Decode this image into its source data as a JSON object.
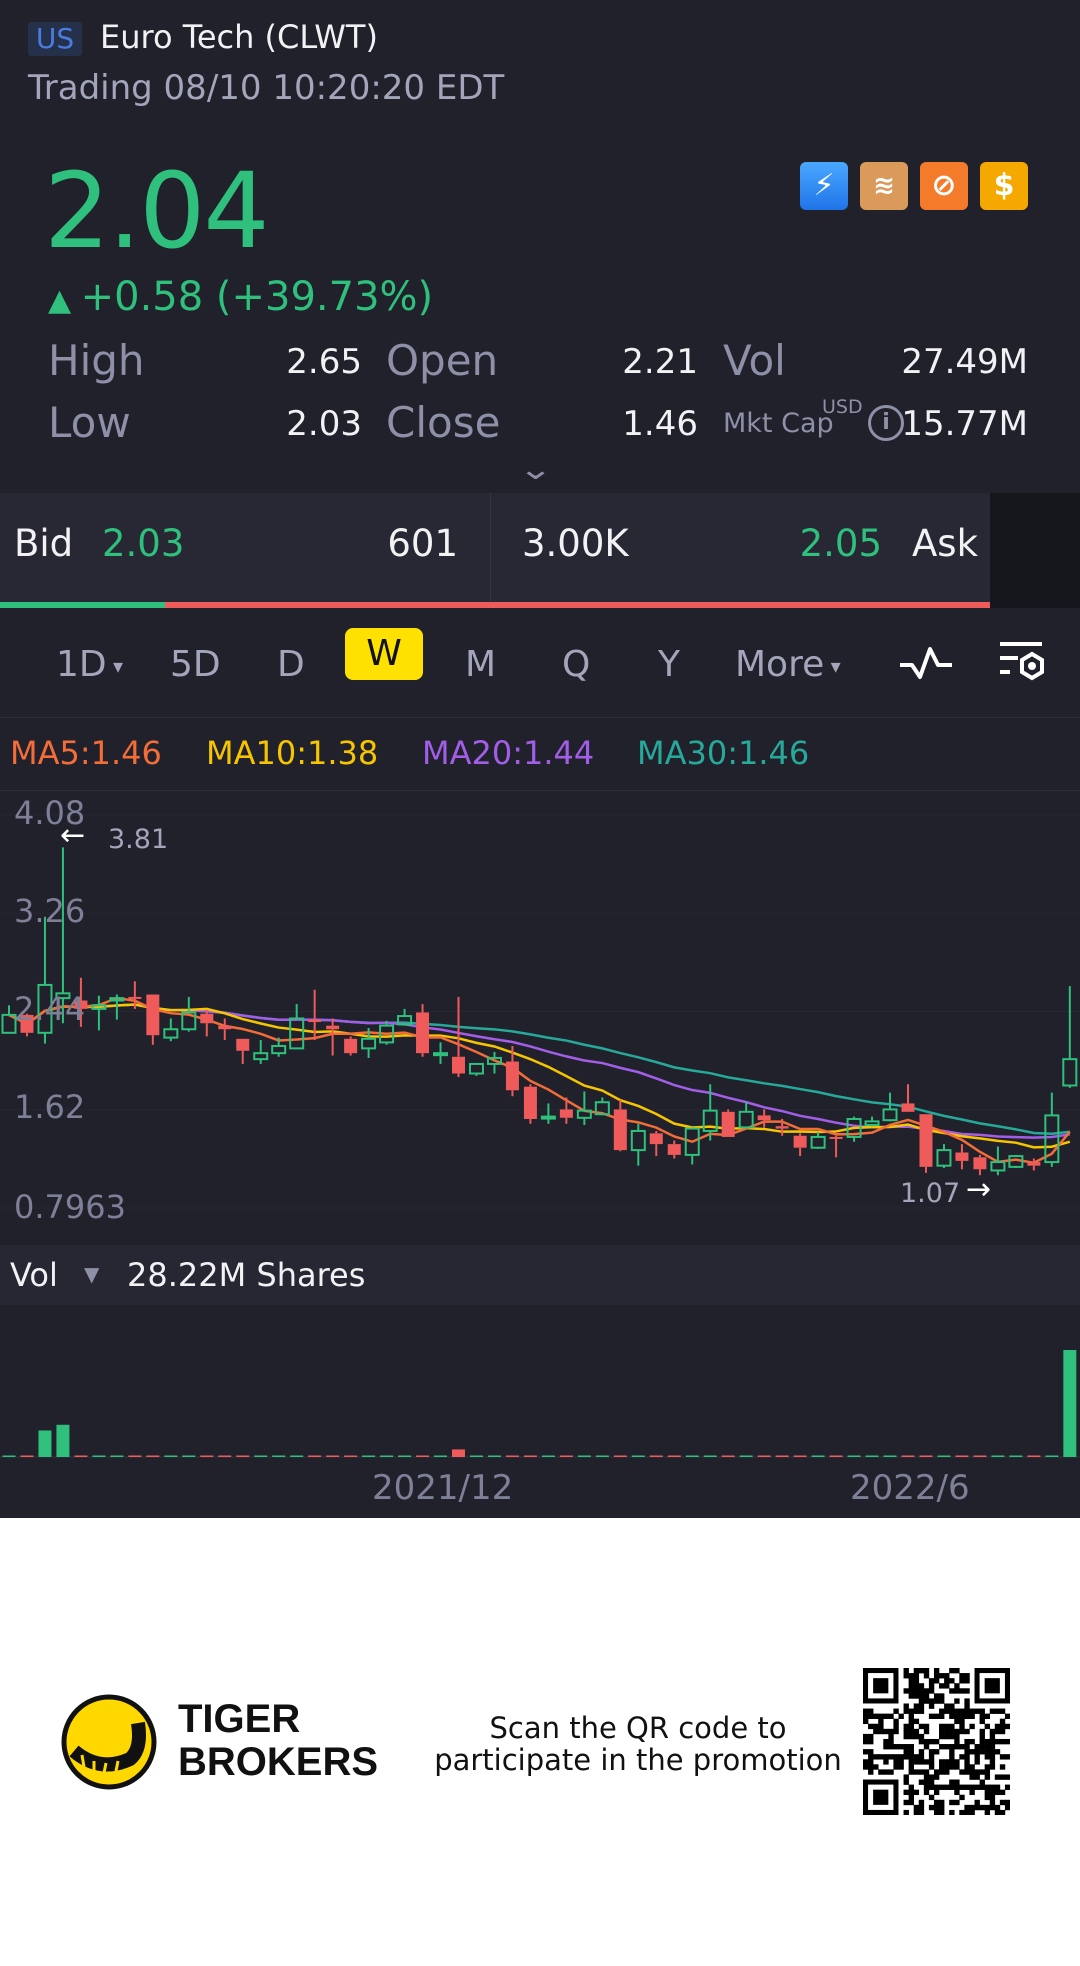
{
  "header": {
    "market": "US",
    "title": "Euro Tech (CLWT)",
    "status": "Trading 08/10 10:20:20 EDT"
  },
  "quote": {
    "price": "2.04",
    "change": "+0.58 (+39.73%)",
    "stats": {
      "high_label": "High",
      "high": "2.65",
      "open_label": "Open",
      "open": "2.21",
      "vol_label": "Vol",
      "vol": "27.49M",
      "low_label": "Low",
      "low": "2.03",
      "close_label": "Close",
      "close": "1.46",
      "mktcap_label": "Mkt Cap",
      "mktcap_currency": "USD",
      "mktcap": "15.77M"
    },
    "badges": [
      "lightning-1-icon",
      "layers-a-icon",
      "no-short-icon",
      "dollar-icon"
    ]
  },
  "bidask": {
    "bid_label": "Bid",
    "bid": "2.03",
    "bid_size": "601",
    "ask_size": "3.00K",
    "ask": "2.05",
    "ask_label": "Ask",
    "bid_ratio": 0.167
  },
  "tabs": {
    "items": [
      "1D",
      "5D",
      "D",
      "W",
      "M",
      "Q",
      "Y",
      "More"
    ],
    "selected": "W"
  },
  "colors": {
    "up": "#2ec07c",
    "down": "#ef5b5b",
    "ma5": "#f26d38",
    "ma10": "#f7c500",
    "ma20": "#a35ee8",
    "ma30": "#27a99a",
    "accent": "#ffe100"
  },
  "chart_data": {
    "type": "candlestick",
    "period": "weekly",
    "ma_legend": {
      "ma5": "MA5:1.46",
      "ma10": "MA10:1.38",
      "ma20": "MA20:1.44",
      "ma30": "MA30:1.46"
    },
    "y_ticks": [
      "4.08",
      "3.26",
      "2.44",
      "1.62",
      "0.7963"
    ],
    "ylim": [
      0.7963,
      4.08
    ],
    "max_marker": "3.81",
    "min_marker": "1.07",
    "x_ticks": [
      "2021/12",
      "2022/6"
    ],
    "x_tick_index": [
      24.5,
      50.5
    ],
    "ohlc": [
      [
        2.26,
        2.49,
        2.26,
        2.41
      ],
      [
        2.41,
        2.42,
        2.23,
        2.26
      ],
      [
        2.26,
        3.23,
        2.17,
        2.66
      ],
      [
        2.55,
        3.81,
        2.34,
        2.59
      ],
      [
        2.53,
        2.72,
        2.31,
        2.46
      ],
      [
        2.46,
        2.57,
        2.28,
        2.49
      ],
      [
        2.53,
        2.58,
        2.37,
        2.55
      ],
      [
        2.56,
        2.69,
        2.46,
        2.55
      ],
      [
        2.58,
        2.58,
        2.16,
        2.24
      ],
      [
        2.22,
        2.38,
        2.19,
        2.29
      ],
      [
        2.29,
        2.56,
        2.27,
        2.43
      ],
      [
        2.42,
        2.45,
        2.23,
        2.34
      ],
      [
        2.32,
        2.38,
        2.2,
        2.29
      ],
      [
        2.21,
        2.21,
        2.0,
        2.11
      ],
      [
        2.04,
        2.2,
        2.0,
        2.09
      ],
      [
        2.09,
        2.22,
        2.06,
        2.15
      ],
      [
        2.13,
        2.5,
        2.13,
        2.38
      ],
      [
        2.37,
        2.62,
        2.2,
        2.35
      ],
      [
        2.32,
        2.38,
        2.07,
        2.29
      ],
      [
        2.21,
        2.23,
        2.07,
        2.09
      ],
      [
        2.13,
        2.3,
        2.05,
        2.21
      ],
      [
        2.18,
        2.36,
        2.16,
        2.32
      ],
      [
        2.33,
        2.46,
        2.32,
        2.4
      ],
      [
        2.43,
        2.5,
        2.06,
        2.09
      ],
      [
        2.08,
        2.18,
        2.0,
        2.09
      ],
      [
        2.06,
        2.56,
        1.89,
        1.92
      ],
      [
        1.92,
        2.0,
        1.9,
        2.0
      ],
      [
        2.0,
        2.1,
        1.92,
        2.05
      ],
      [
        2.02,
        2.15,
        1.73,
        1.78
      ],
      [
        1.81,
        1.83,
        1.5,
        1.54
      ],
      [
        1.55,
        1.67,
        1.5,
        1.56
      ],
      [
        1.62,
        1.72,
        1.5,
        1.55
      ],
      [
        1.55,
        1.77,
        1.49,
        1.61
      ],
      [
        1.58,
        1.72,
        1.57,
        1.68
      ],
      [
        1.62,
        1.7,
        1.27,
        1.28
      ],
      [
        1.28,
        1.5,
        1.15,
        1.44
      ],
      [
        1.42,
        1.44,
        1.23,
        1.33
      ],
      [
        1.33,
        1.36,
        1.21,
        1.24
      ],
      [
        1.24,
        1.47,
        1.16,
        1.46
      ],
      [
        1.44,
        1.83,
        1.36,
        1.61
      ],
      [
        1.6,
        1.62,
        1.39,
        1.39
      ],
      [
        1.47,
        1.68,
        1.46,
        1.6
      ],
      [
        1.57,
        1.62,
        1.47,
        1.53
      ],
      [
        1.48,
        1.54,
        1.4,
        1.46
      ],
      [
        1.4,
        1.42,
        1.23,
        1.3
      ],
      [
        1.3,
        1.43,
        1.29,
        1.39
      ],
      [
        1.39,
        1.4,
        1.22,
        1.38
      ],
      [
        1.39,
        1.56,
        1.35,
        1.54
      ],
      [
        1.49,
        1.56,
        1.48,
        1.52
      ],
      [
        1.53,
        1.76,
        1.52,
        1.62
      ],
      [
        1.67,
        1.83,
        1.6,
        1.6
      ],
      [
        1.58,
        1.58,
        1.09,
        1.14
      ],
      [
        1.15,
        1.33,
        1.13,
        1.28
      ],
      [
        1.26,
        1.33,
        1.12,
        1.19
      ],
      [
        1.22,
        1.24,
        1.07,
        1.12
      ],
      [
        1.11,
        1.31,
        1.07,
        1.18
      ],
      [
        1.14,
        1.24,
        1.13,
        1.23
      ],
      [
        1.18,
        1.21,
        1.11,
        1.15
      ],
      [
        1.18,
        1.76,
        1.14,
        1.57
      ],
      [
        1.82,
        2.65,
        1.8,
        2.04
      ]
    ],
    "volume_label": "Vol",
    "volume_value": "28.22M Shares",
    "volume_millions": [
      0.3,
      0.2,
      7.0,
      8.5,
      0.2,
      0.1,
      0.1,
      0.1,
      0.1,
      0.1,
      0.1,
      0.1,
      0.1,
      0.1,
      0.1,
      0.1,
      0.1,
      0.1,
      0.1,
      0.1,
      0.1,
      0.1,
      0.1,
      0.1,
      0.1,
      2.0,
      0.1,
      0.1,
      0.1,
      0.1,
      0.1,
      0.1,
      0.1,
      0.1,
      0.1,
      0.1,
      0.1,
      0.1,
      0.1,
      0.1,
      0.1,
      0.1,
      0.1,
      0.1,
      0.1,
      0.1,
      0.1,
      0.1,
      0.1,
      0.1,
      0.1,
      0.1,
      0.1,
      0.1,
      0.1,
      0.1,
      0.1,
      0.1,
      0.3,
      28.22
    ]
  },
  "footer": {
    "brand_line1": "TIGER",
    "brand_line2": "BROKERS",
    "promo_line1": "Scan the QR code to",
    "promo_line2": "participate in the promotion"
  }
}
